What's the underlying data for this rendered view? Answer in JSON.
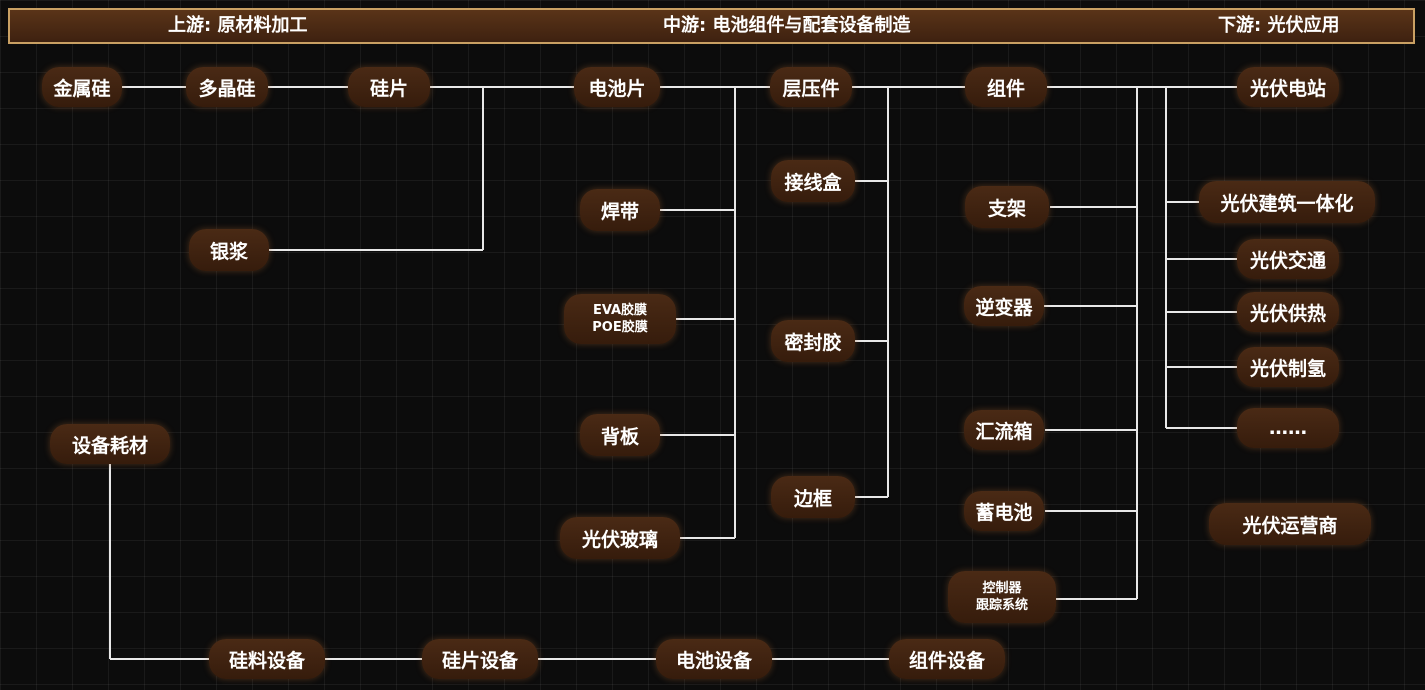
{
  "stages": {
    "upstream": "上游: 原材料加工",
    "midstream": "中游: 电池组件与配套设备制造",
    "downstream": "下游: 光伏应用"
  },
  "nodes": {
    "jinshugui": "金属硅",
    "duojinggui": "多晶硅",
    "guipian": "硅片",
    "yinjiang": "银浆",
    "dianchipian": "电池片",
    "handai": "焊带",
    "eva_line1": "EVA胶膜",
    "eva_line2": "POE胶膜",
    "beiban": "背板",
    "boli": "光伏玻璃",
    "cengyajian": "层压件",
    "jiexianhe": "接线盒",
    "mifengjiao": "密封胶",
    "biankuang": "边框",
    "zujian": "组件",
    "zhijia": "支架",
    "nibianqi": "逆变器",
    "huiliuxiang": "汇流箱",
    "xudianchi": "蓄电池",
    "kongzhi_line1": "控制器",
    "kongzhi_line2": "跟踪系统",
    "dianzhan": "光伏电站",
    "jianzhu": "光伏建筑一体化",
    "jiaotong": "光伏交通",
    "gongre": "光伏供热",
    "zhiqing": "光伏制氢",
    "more": "……",
    "yunyingshang": "光伏运营商",
    "shebei_haocai": "设备耗材",
    "guiliao_shebei": "硅料设备",
    "guipian_shebei": "硅片设备",
    "dianchi_shebei": "电池设备",
    "zujian_shebei": "组件设备"
  },
  "colors": {
    "header_border": "#c9a063",
    "header_fill": "#4a2a15",
    "node_fill": "#3f2212",
    "connector": "#e8e8e8",
    "background": "#0c0c0c"
  }
}
